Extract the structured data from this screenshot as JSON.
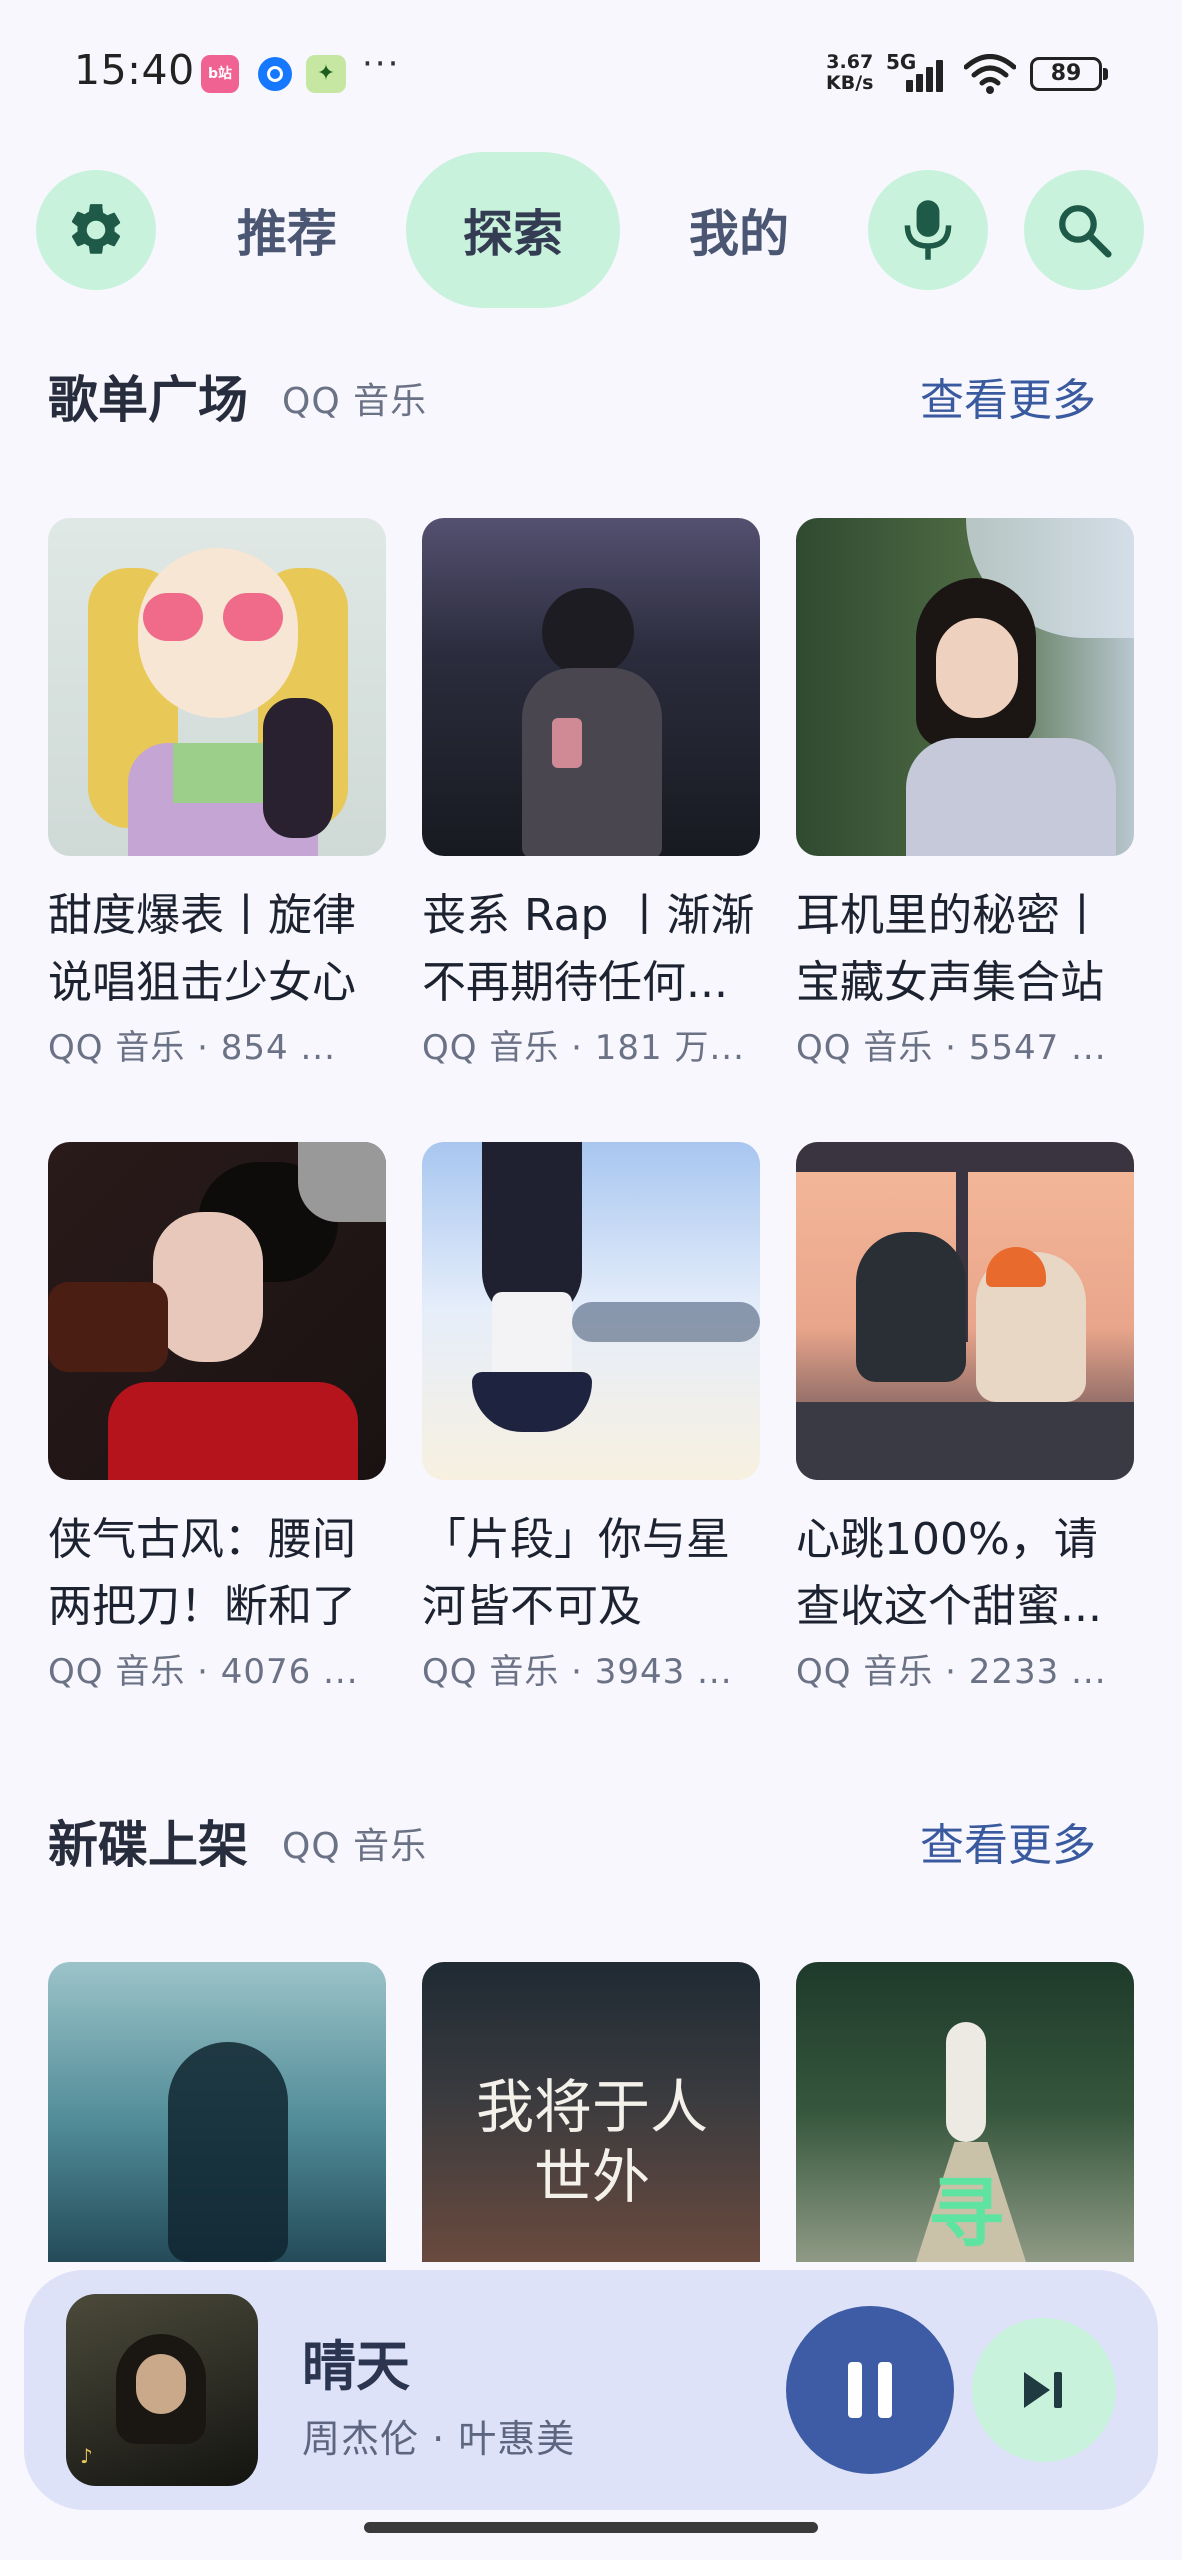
{
  "status_bar": {
    "time": "15:40",
    "app_icons": [
      "bilibili-icon",
      "blue-app-icon",
      "green-app-icon"
    ],
    "bili_label": "bilibili",
    "more": "···",
    "net_speed_value": "3.67",
    "net_speed_unit": "KB/s",
    "network_type": "5G",
    "battery": "89"
  },
  "nav": {
    "tabs": [
      {
        "label": "推荐",
        "active": false
      },
      {
        "label": "探索",
        "active": true
      },
      {
        "label": "我的",
        "active": false
      }
    ],
    "icons": [
      "gear-icon",
      "mic-icon",
      "search-icon"
    ],
    "accent_color": "#c8f2dc"
  },
  "playlist_section": {
    "title": "歌单广场",
    "source": "QQ 音乐",
    "see_more": "查看更多",
    "items": [
      {
        "title": "甜度爆表丨旋律说唱狙击少女心",
        "subtitle": "QQ 音乐 · 854 ..."
      },
      {
        "title": "丧系 Rap 丨渐渐不再期待任何...",
        "subtitle": "QQ 音乐 · 181 万..."
      },
      {
        "title": "耳机里的秘密丨宝藏女声集合站",
        "subtitle": "QQ 音乐 · 5547 ..."
      },
      {
        "title": "侠气古风：腰间两把刀！断和了",
        "subtitle": "QQ 音乐 · 4076 ..."
      },
      {
        "title": "「片段」你与星河皆不可及",
        "subtitle": "QQ 音乐 · 3943 ..."
      },
      {
        "title": "心跳100%，请查收这个甜蜜...",
        "subtitle": "QQ 音乐 · 2233 ..."
      }
    ]
  },
  "album_section": {
    "title": "新碟上架",
    "source": "QQ 音乐",
    "see_more": "查看更多",
    "items": [
      {
        "cover_text": ""
      },
      {
        "cover_text": "我将于人世外"
      },
      {
        "cover_text": "寻"
      }
    ]
  },
  "player": {
    "title": "晴天",
    "artist": "周杰伦 · 叶惠美",
    "state": "playing",
    "pause_color": "#3d5ca5"
  }
}
